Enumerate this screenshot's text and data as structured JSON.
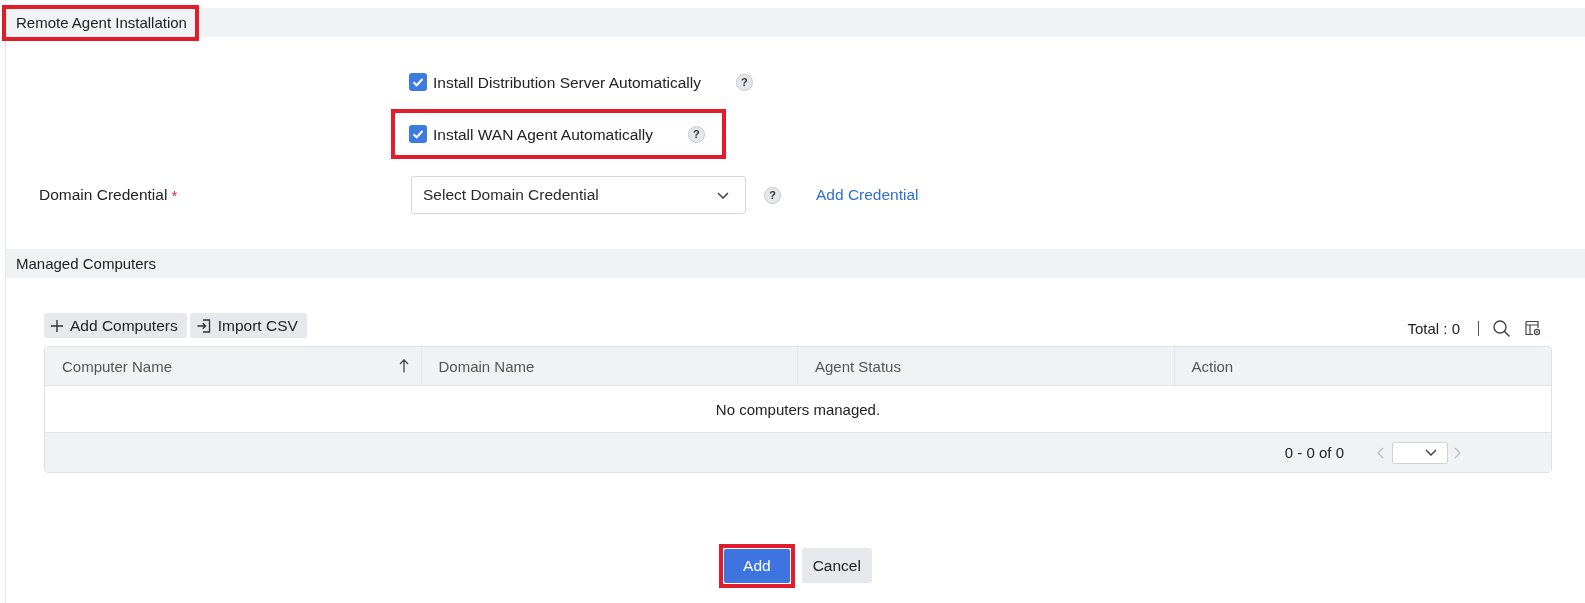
{
  "installation": {
    "title": "Remote Agent Installation",
    "highlighted": true,
    "options": [
      {
        "label": "Install Distribution Server Automatically",
        "checked": true,
        "highlighted": false,
        "help": "?"
      },
      {
        "label": "Install WAN Agent Automatically",
        "checked": true,
        "highlighted": true,
        "help": "?"
      }
    ],
    "credential": {
      "label": "Domain Credential",
      "required_mark": "*",
      "placeholder": "Select Domain Credential",
      "help": "?",
      "link": "Add Credential"
    }
  },
  "managed": {
    "title": "Managed Computers",
    "toolbar": [
      {
        "kind": "add",
        "label": "Add Computers"
      },
      {
        "kind": "import",
        "label": "Import CSV"
      }
    ],
    "total": "Total : 0",
    "table": {
      "columns": [
        {
          "label": "Computer Name",
          "sorted": true
        },
        {
          "label": "Domain Name",
          "sorted": false
        },
        {
          "label": "Agent Status",
          "sorted": false
        },
        {
          "label": "Action",
          "sorted": false
        }
      ],
      "empty_message": "No computers managed.",
      "pager": {
        "range": "0 - 0 of 0",
        "prev_disabled": true,
        "next_disabled": true
      }
    }
  },
  "buttons": [
    {
      "kind": "primary",
      "label": "Add",
      "highlighted": true
    },
    {
      "kind": "secondary",
      "label": "Cancel",
      "highlighted": false
    }
  ]
}
